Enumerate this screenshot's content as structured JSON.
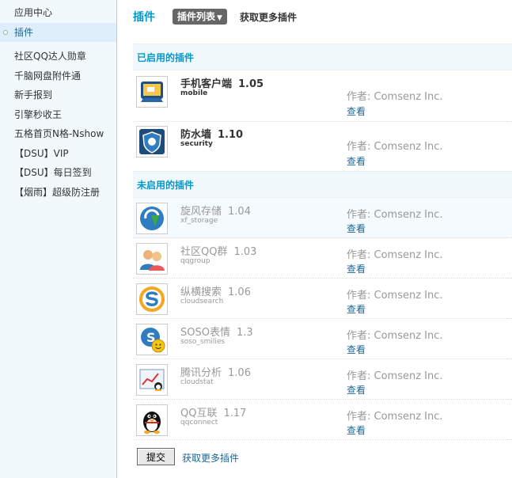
{
  "sidebar": {
    "items": [
      {
        "label": "应用中心"
      },
      {
        "label": "插件"
      },
      {
        "label": "社区QQ达人勋章"
      },
      {
        "label": "千脑网盘附件通"
      },
      {
        "label": "新手报到"
      },
      {
        "label": "引擎秒收王"
      },
      {
        "label": "五格首页N格-Nshow"
      },
      {
        "label": "【DSU】VIP"
      },
      {
        "label": "【DSU】每日签到"
      },
      {
        "label": "【烟雨】超级防注册"
      }
    ]
  },
  "header": {
    "title": "插件",
    "tab_label": "插件列表",
    "more_link": "获取更多插件"
  },
  "sections": {
    "enabled_title": "已启用的插件",
    "disabled_title": "未启用的插件"
  },
  "enabled_plugins": [
    {
      "name": "手机客户端",
      "version": "1.05",
      "id": "mobile",
      "author": "作者: Comsenz Inc.",
      "view": "查看",
      "icon": "mobile-icon"
    },
    {
      "name": "防水墙",
      "version": "1.10",
      "id": "security",
      "author": "作者: Comsenz Inc.",
      "view": "查看",
      "icon": "shield-icon"
    }
  ],
  "disabled_plugins": [
    {
      "name": "旋风存储",
      "version": "1.04",
      "id": "xf_storage",
      "author": "作者: Comsenz Inc.",
      "view": "查看",
      "icon": "storage-icon"
    },
    {
      "name": "社区QQ群",
      "version": "1.03",
      "id": "qqgroup",
      "author": "作者: Comsenz Inc.",
      "view": "查看",
      "icon": "group-icon"
    },
    {
      "name": "纵横搜索",
      "version": "1.06",
      "id": "cloudsearch",
      "author": "作者: Comsenz Inc.",
      "view": "查看",
      "icon": "search-icon"
    },
    {
      "name": "SOSO表情",
      "version": "1.3",
      "id": "soso_smilies",
      "author": "作者: Comsenz Inc.",
      "view": "查看",
      "icon": "smiley-icon"
    },
    {
      "name": "腾讯分析",
      "version": "1.06",
      "id": "cloudstat",
      "author": "作者: Comsenz Inc.",
      "view": "查看",
      "icon": "chart-icon"
    },
    {
      "name": "QQ互联",
      "version": "1.17",
      "id": "qqconnect",
      "author": "作者: Comsenz Inc.",
      "view": "查看",
      "icon": "penguin-icon"
    }
  ],
  "footer": {
    "submit_label": "提交",
    "more_link": "获取更多插件"
  },
  "colors": {
    "accent": "#0099cc",
    "link": "#1a6899",
    "sidebar_bg": "#f2f9fd"
  }
}
